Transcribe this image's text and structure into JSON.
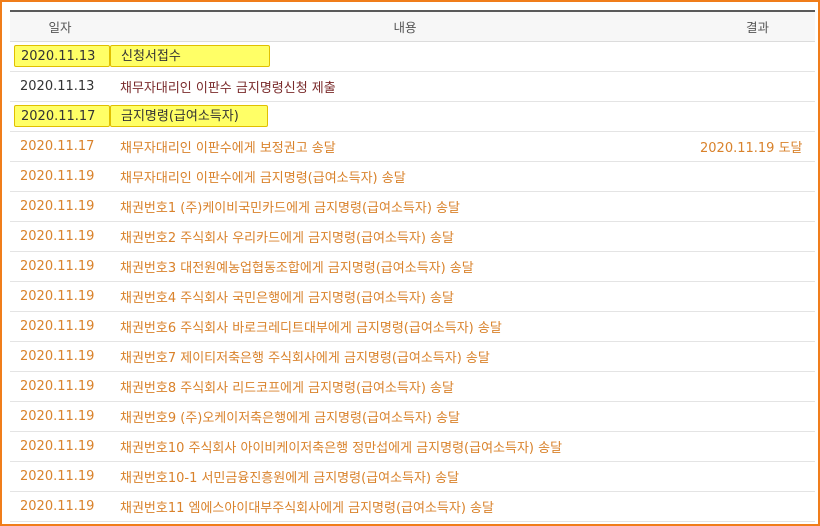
{
  "header": {
    "date": "일자",
    "content": "내용",
    "result": "결과"
  },
  "colors": {
    "frame": "#f07d1a",
    "highlight": "#ffff66",
    "dark": "#333333",
    "orange": "#d9822b",
    "maroon": "#7a2b2b"
  },
  "rows": [
    {
      "date": "2020.11.13",
      "content": "신청서접수",
      "result": ""
    },
    {
      "date": "2020.11.13",
      "content": "채무자대리인 이판수 금지명령신청 제출",
      "result": ""
    },
    {
      "date": "2020.11.17",
      "content": "금지명령(급여소득자)",
      "result": ""
    },
    {
      "date": "2020.11.17",
      "content": "채무자대리인 이판수에게 보정권고 송달",
      "result": "2020.11.19 도달"
    },
    {
      "date": "2020.11.19",
      "content": "채무자대리인 이판수에게 금지명령(급여소득자) 송달",
      "result": ""
    },
    {
      "date": "2020.11.19",
      "content": "채권번호1 (주)케이비국민카드에게 금지명령(급여소득자) 송달",
      "result": ""
    },
    {
      "date": "2020.11.19",
      "content": "채권번호2 주식회사 우리카드에게 금지명령(급여소득자) 송달",
      "result": ""
    },
    {
      "date": "2020.11.19",
      "content": "채권번호3 대전원예농업협동조합에게 금지명령(급여소득자) 송달",
      "result": ""
    },
    {
      "date": "2020.11.19",
      "content": "채권번호4 주식회사 국민은행에게 금지명령(급여소득자) 송달",
      "result": ""
    },
    {
      "date": "2020.11.19",
      "content": "채권번호6 주식회사 바로크레디트대부에게 금지명령(급여소득자) 송달",
      "result": ""
    },
    {
      "date": "2020.11.19",
      "content": "채권번호7 제이티저축은행 주식회사에게 금지명령(급여소득자) 송달",
      "result": ""
    },
    {
      "date": "2020.11.19",
      "content": "채권번호8 주식회사 리드코프에게 금지명령(급여소득자) 송달",
      "result": ""
    },
    {
      "date": "2020.11.19",
      "content": "채권번호9 (주)오케이저축은행에게 금지명령(급여소득자) 송달",
      "result": ""
    },
    {
      "date": "2020.11.19",
      "content": "채권번호10 주식회사 아이비케이저축은행 정만섭에게 금지명령(급여소득자) 송달",
      "result": ""
    },
    {
      "date": "2020.11.19",
      "content": "채권번호10-1 서민금융진흥원에게 금지명령(급여소득자) 송달",
      "result": ""
    },
    {
      "date": "2020.11.19",
      "content": "채권번호11 엠에스아이대부주식회사에게 금지명령(급여소득자) 송달",
      "result": ""
    }
  ]
}
